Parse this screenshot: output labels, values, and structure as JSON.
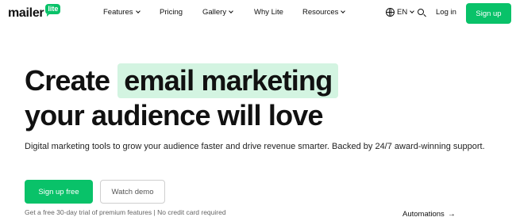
{
  "nav": {
    "logo": {
      "word": "mailer",
      "badge": "lite"
    },
    "items": [
      {
        "label": "Features",
        "has_dropdown": true
      },
      {
        "label": "Pricing",
        "has_dropdown": false
      },
      {
        "label": "Gallery",
        "has_dropdown": true
      },
      {
        "label": "Why Lite",
        "has_dropdown": false
      },
      {
        "label": "Resources",
        "has_dropdown": true
      }
    ],
    "language": {
      "label": "EN",
      "icon": "globe-icon"
    },
    "search_icon": "search-icon",
    "login": "Log in",
    "signup": "Sign up"
  },
  "hero": {
    "title_part1": "Create",
    "title_highlight": "email marketing",
    "title_line2": "your audience will love",
    "subtitle": "Digital marketing tools to grow your audience faster and drive revenue smarter. Backed by 24/7 award-winning support.",
    "cta_primary": "Sign up free",
    "cta_secondary": "Watch demo",
    "trial_note": "Get a free 30-day trial of premium features | No credit card required",
    "automations_link": "Automations",
    "automations_arrow": "→"
  },
  "colors": {
    "brand_green": "#09c269",
    "highlight_bg": "#d3f4e1",
    "text": "#111111"
  }
}
